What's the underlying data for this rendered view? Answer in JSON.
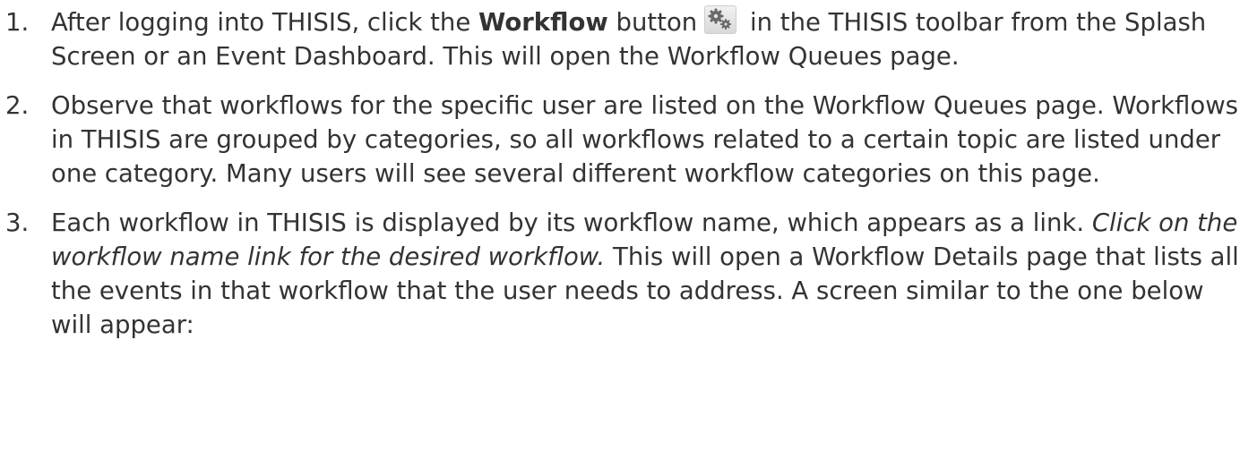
{
  "steps": [
    {
      "number": "1.",
      "part1": "After logging into THISIS, click the ",
      "bold": "Workflow",
      "part2": " button",
      "icon": "gears-icon",
      "part3": " in the THISIS toolbar from the Splash Screen or an Event Dashboard. This will open the Workflow Queues page."
    },
    {
      "number": "2.",
      "text": "Observe that workflows for the specific user are listed on the Workflow Queues page. Workflows in THISIS are grouped by categories, so all workflows related to a certain topic are listed under one category. Many users will see several different workflow categories on this page."
    },
    {
      "number": "3.",
      "part1": "Each workflow in THISIS is displayed by its workflow name, which appears as a link. ",
      "italic": "Click on the workflow name link for the desired workflow.",
      "part2": " This will open a Workflow Details page that lists all the events in that workflow that the user needs to address. A screen similar to the one below will appear:"
    }
  ]
}
